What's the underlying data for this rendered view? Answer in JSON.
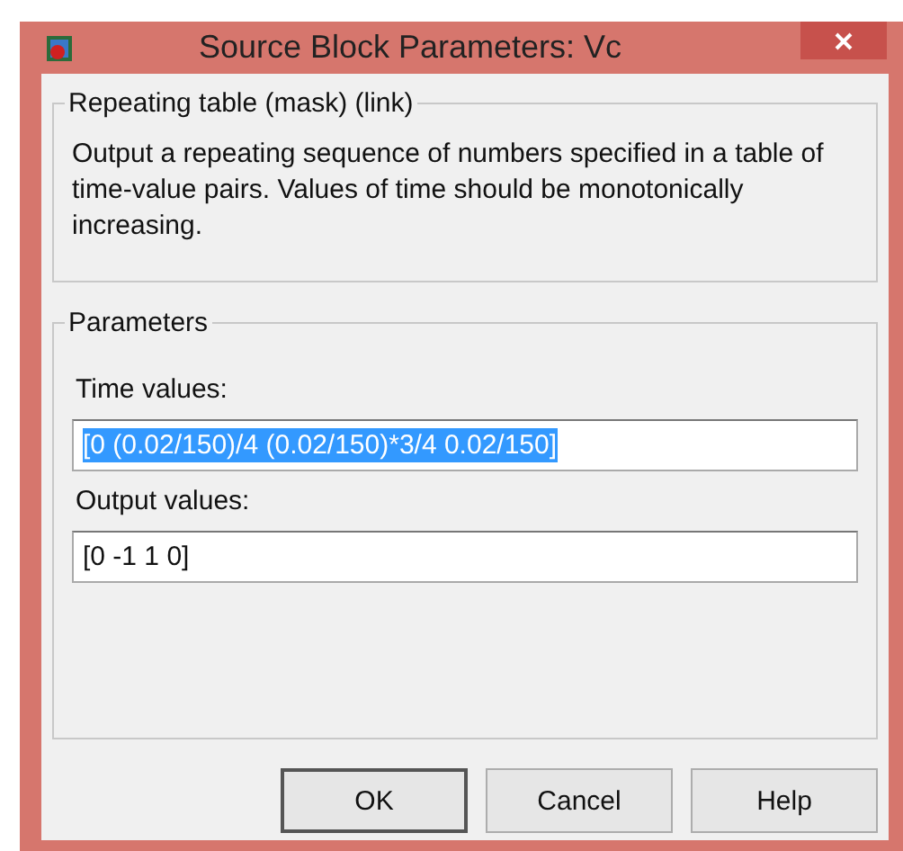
{
  "window": {
    "title": "Source Block Parameters: Vc"
  },
  "description_group": {
    "title": "Repeating table (mask) (link)",
    "text": "Output a repeating sequence of numbers specified in a table of time-value pairs. Values of time should be monotonically increasing."
  },
  "parameters_group": {
    "title": "Parameters",
    "fields": [
      {
        "label": "Time values:",
        "value": "[0 (0.02/150)/4 (0.02/150)*3/4 0.02/150]",
        "text_selected": true
      },
      {
        "label": "Output values:",
        "value": "[0 -1 1 0]",
        "text_selected": false
      }
    ]
  },
  "buttons": [
    {
      "label": "OK",
      "default": true
    },
    {
      "label": "Cancel",
      "default": false
    },
    {
      "label": "Help",
      "default": false
    }
  ]
}
